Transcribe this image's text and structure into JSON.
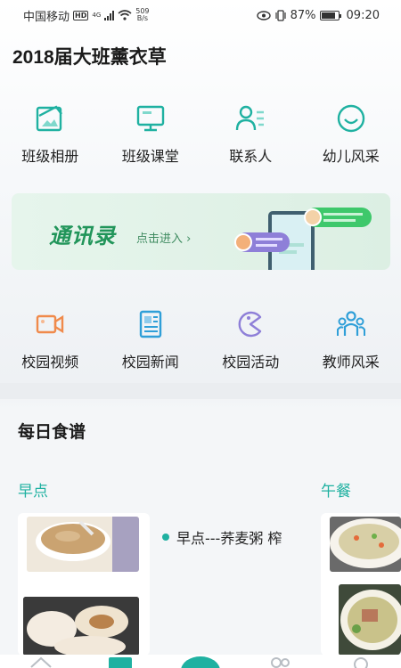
{
  "status": {
    "carrier": "中国移动",
    "hd": "HD",
    "net": "4G",
    "speed_value": "509",
    "speed_unit": "B/s",
    "battery": "87%",
    "time": "09:20"
  },
  "page_title": "2018届大班薰衣草",
  "top_grid": [
    {
      "label": "班级相册",
      "icon": "album-icon"
    },
    {
      "label": "班级课堂",
      "icon": "monitor-icon"
    },
    {
      "label": "联系人",
      "icon": "contacts-icon"
    },
    {
      "label": "幼儿风采",
      "icon": "smile-icon"
    }
  ],
  "banner": {
    "title": "通讯录",
    "link": "点击进入 ›"
  },
  "bottom_grid": [
    {
      "label": "校园视频",
      "icon": "video-icon"
    },
    {
      "label": "校园新闻",
      "icon": "news-icon"
    },
    {
      "label": "校园活动",
      "icon": "activity-icon"
    },
    {
      "label": "教师风采",
      "icon": "teachers-icon"
    }
  ],
  "recipes": {
    "title": "每日食谱",
    "breakfast_label": "早点",
    "lunch_label": "午餐",
    "breakfast_dish": "早点---荞麦粥 榨"
  },
  "colors": {
    "teal": "#1fb1a1",
    "green": "#21955a",
    "orange": "#f08a4b",
    "purple": "#8e7fd8",
    "blue": "#2f9fd8"
  }
}
